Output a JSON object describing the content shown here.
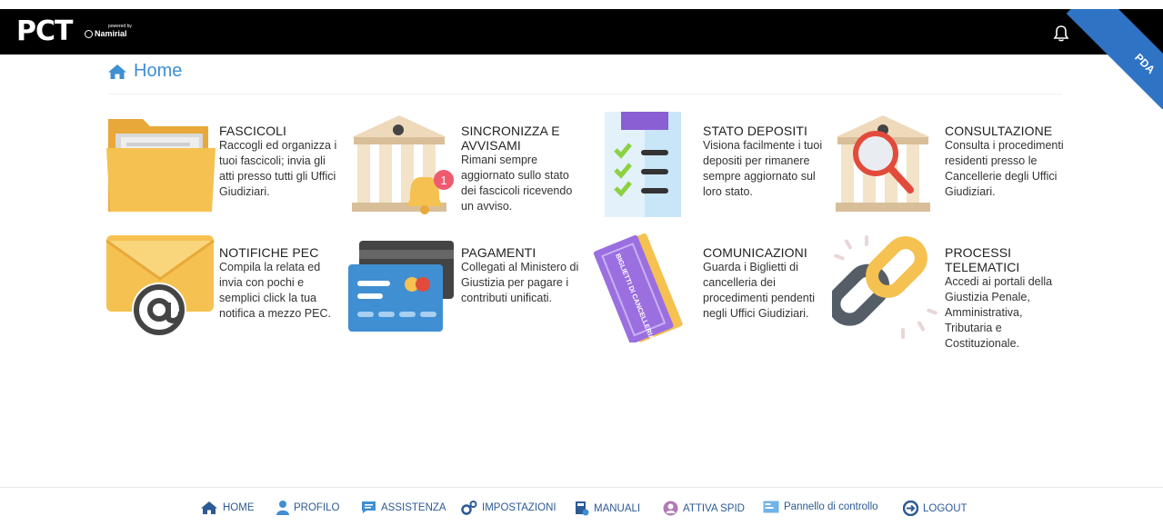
{
  "header": {
    "logo_text": "PCT",
    "powered_by": "powered by",
    "brand": "Namirial",
    "corner_label": "PDA"
  },
  "breadcrumb": {
    "title": "Home"
  },
  "tiles": [
    {
      "title": "FASCICOLI",
      "desc": "Raccogli ed organizza i tuoi fascicoli; invia gli atti presso tutti gli Uffici Giudiziari."
    },
    {
      "title": "SINCRONIZZA E AVVISAMI",
      "desc": "Rimani sempre aggiornato sullo stato dei fascicoli ricevendo un avviso.",
      "badge": "1"
    },
    {
      "title": "STATO DEPOSITI",
      "desc": "Visiona facilmente i tuoi depositi per rimanere sempre aggiornato sul loro stato."
    },
    {
      "title": "CONSULTAZIONE",
      "desc": "Consulta i procedimenti residenti presso le Cancellerie degli Uffici Giudiziari."
    },
    {
      "title": "NOTIFICHE PEC",
      "desc": "Compila la relata ed invia con pochi e semplici click la tua notifica a mezzo PEC."
    },
    {
      "title": "PAGAMENTI",
      "desc": "Collegati al Ministero di Giustizia per pagare i contributi unificati."
    },
    {
      "title": "COMUNICAZIONI",
      "desc": "Guarda i Biglietti di cancelleria dei procedimenti pendenti negli Uffici Giudiziari.",
      "ticket_text": "BIGLIETTI DI CANCELLERIA"
    },
    {
      "title": "PROCESSI TELEMATICI",
      "desc": "Accedi ai portali della Giustizia Penale, Amministrativa, Tributaria e Costituzionale."
    }
  ],
  "footer": {
    "home": "HOME",
    "profilo": "PROFILO",
    "assistenza": "ASSISTENZA",
    "impostazioni": "IMPOSTAZIONI",
    "manuali": "MANUALI",
    "attiva_spid": "ATTIVA SPID",
    "pannello": "Pannello di controllo",
    "logout": "LOGOUT"
  },
  "colors": {
    "link": "#3f8fd2",
    "footer_link": "#2c5a95",
    "ribbon": "#2f74c4",
    "folder": "#f5c150"
  }
}
